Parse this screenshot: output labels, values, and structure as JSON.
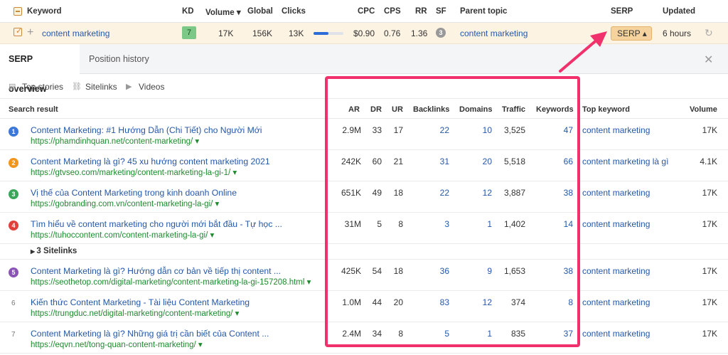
{
  "header": {
    "keyword": "Keyword",
    "kd": "KD",
    "volume": "Volume ▾",
    "global": "Global",
    "clicks": "Clicks",
    "cpc": "CPC",
    "cps": "CPS",
    "rr": "RR",
    "sf": "SF",
    "parent_topic": "Parent topic",
    "serp": "SERP",
    "updated": "Updated"
  },
  "keyword_row": {
    "keyword": "content marketing",
    "kd": "7",
    "volume": "17K",
    "global": "156K",
    "clicks": "13K",
    "clicks_bar_fraction": 0.5,
    "cpc": "$0.90",
    "cps": "0.76",
    "rr": "1.36",
    "sf": "3",
    "parent_topic": "content marketing",
    "serp_button": "SERP ▴",
    "updated": "6 hours"
  },
  "tabs": {
    "serp_overview": "SERP overview",
    "position_history": "Position history"
  },
  "features": {
    "top_stories": "Top stories",
    "sitelinks": "Sitelinks",
    "videos": "Videos"
  },
  "columns": {
    "search_result": "Search result",
    "ar": "AR",
    "dr": "DR",
    "ur": "UR",
    "backlinks": "Backlinks",
    "domains": "Domains",
    "traffic": "Traffic",
    "keywords": "Keywords",
    "top_keyword": "Top keyword",
    "volume": "Volume"
  },
  "rows": [
    {
      "rank": "1",
      "rank_color": "#3c78d8",
      "title": "Content Marketing: #1 Hướng Dẫn (Chi Tiết) cho Người Mới",
      "url": "https://phamdinhquan.net/content-marketing/ ▾",
      "ar": "2.9M",
      "dr": "33",
      "ur": "17",
      "backlinks": "22",
      "domains": "10",
      "traffic": "3,525",
      "keywords": "47",
      "top_keyword": "content marketing",
      "volume": "17K"
    },
    {
      "rank": "2",
      "rank_color": "#f0961e",
      "title": "Content Marketing là gì? 45 xu hướng content marketing 2021",
      "url": "https://gtvseo.com/marketing/content-marketing-la-gi-1/ ▾",
      "ar": "242K",
      "dr": "60",
      "ur": "21",
      "backlinks": "31",
      "domains": "20",
      "traffic": "5,518",
      "keywords": "66",
      "top_keyword": "content marketing là gì",
      "volume": "4.1K"
    },
    {
      "rank": "3",
      "rank_color": "#3aa65a",
      "title": "Vị thế của Content Marketing trong kinh doanh Online",
      "url": "https://gobranding.com.vn/content-marketing-la-gi/ ▾",
      "ar": "651K",
      "dr": "49",
      "ur": "18",
      "backlinks": "22",
      "domains": "12",
      "traffic": "3,887",
      "keywords": "38",
      "top_keyword": "content marketing",
      "volume": "17K"
    },
    {
      "rank": "4",
      "rank_color": "#e0413a",
      "title": "Tìm hiểu về content marketing cho người mới bắt đầu - Tự học ...",
      "url": "https://tuhoccontent.com/content-marketing-la-gi/ ▾",
      "ar": "31M",
      "dr": "5",
      "ur": "8",
      "backlinks": "3",
      "domains": "1",
      "traffic": "1,402",
      "keywords": "14",
      "top_keyword": "content marketing",
      "volume": "17K"
    },
    {
      "rank": "5",
      "rank_color": "#8a53b5",
      "title": "Content Marketing là gì? Hướng dẫn cơ bản về tiếp thị content ...",
      "url": "https://seothetop.com/digital-marketing/content-marketing-la-gi-157208.html ▾",
      "ar": "425K",
      "dr": "54",
      "ur": "18",
      "backlinks": "36",
      "domains": "9",
      "traffic": "1,653",
      "keywords": "38",
      "top_keyword": "content marketing",
      "volume": "17K"
    },
    {
      "rank": "6",
      "rank_color": "",
      "title": "Kiến thức Content Marketing - Tài liệu Content Marketing",
      "url": "https://trungduc.net/digital-marketing/content-marketing/ ▾",
      "ar": "1.0M",
      "dr": "44",
      "ur": "20",
      "backlinks": "83",
      "domains": "12",
      "traffic": "374",
      "keywords": "8",
      "top_keyword": "content marketing",
      "volume": "17K"
    },
    {
      "rank": "7",
      "rank_color": "",
      "title": "Content Marketing là gì? Những giá trị cần biết của Content ...",
      "url": "https://eqvn.net/tong-quan-content-marketing/ ▾",
      "ar": "2.4M",
      "dr": "34",
      "ur": "8",
      "backlinks": "5",
      "domains": "1",
      "traffic": "835",
      "keywords": "37",
      "top_keyword": "content marketing",
      "volume": "17K"
    }
  ],
  "sitelinks_row": {
    "label": "3 Sitelinks"
  },
  "colors": {
    "accent_pink": "#f0316b",
    "serp_button": "#f6d39e",
    "link_blue": "#2557a7",
    "url_green": "#1f8a2f"
  },
  "icons": [
    "minus-checkbox-icon",
    "checkbox-icon",
    "plus-icon",
    "sort-down-icon",
    "refresh-icon",
    "close-icon",
    "top-stories-icon",
    "sitelinks-icon",
    "videos-icon",
    "caret-right-icon",
    "arrow-annotation-icon"
  ]
}
